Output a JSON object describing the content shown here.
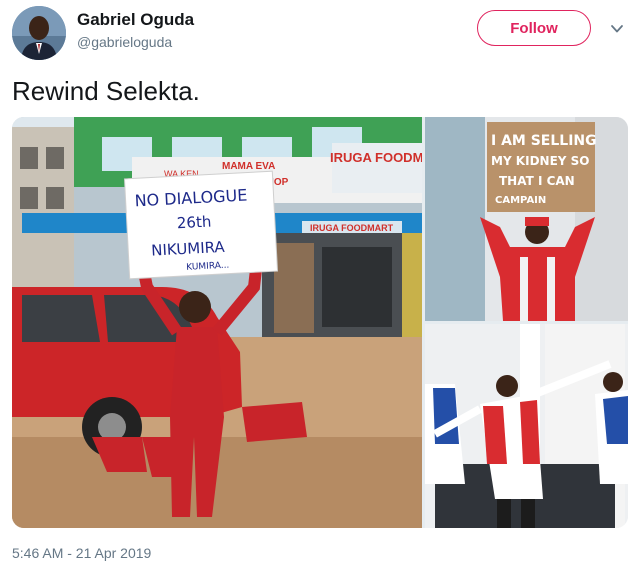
{
  "user": {
    "name": "Gabriel Oguda",
    "handle": "@gabrieloguda"
  },
  "follow_label": "Follow",
  "tweet_text": "Rewind Selekta.",
  "timestamp": "5:46 AM - 21 Apr 2019",
  "colors": {
    "follow_accent": "#e0245e",
    "muted_text": "#657786",
    "primary_text": "#14171a"
  },
  "photos": {
    "main": {
      "shop_sign": "IRUGA FOODMART",
      "shop_sign_2": "MAMA EVA",
      "shop_sign_3": "WA KEN",
      "shop_sign_4": "SHOP",
      "awning": "IRUGA FOODMART",
      "placard_line1": "NO DIALOGUE",
      "placard_line2": "26th",
      "placard_line3": "NIKUMIRA",
      "placard_line4": "KUMIRA..."
    },
    "top_right": {
      "placard_line1": "I AM SELLING",
      "placard_line2": "MY KIDNEY SO",
      "placard_line3": "THAT I CAN",
      "placard_line4": "CAMPAIN"
    }
  }
}
